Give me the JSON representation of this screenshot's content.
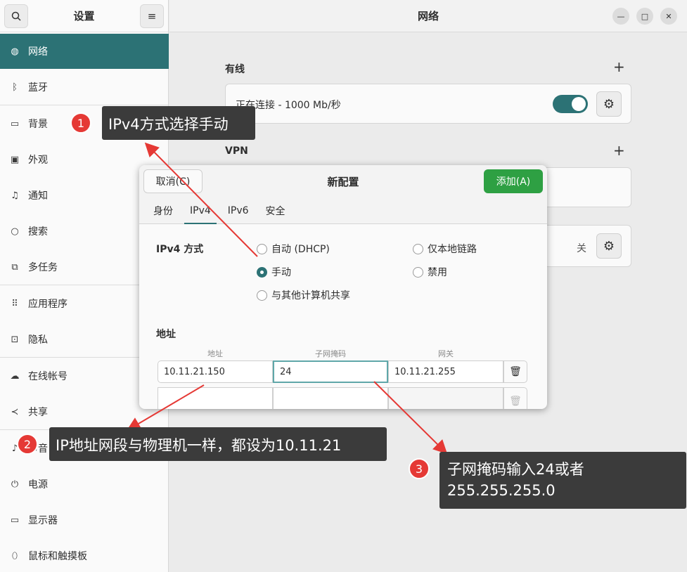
{
  "sidebar": {
    "title": "设置",
    "items": [
      {
        "label": "网络",
        "icon": "globe-icon"
      },
      {
        "label": "蓝牙",
        "icon": "bluetooth-icon"
      },
      {
        "label": "背景",
        "icon": "display-icon"
      },
      {
        "label": "外观",
        "icon": "appearance-icon"
      },
      {
        "label": "通知",
        "icon": "bell-icon"
      },
      {
        "label": "搜索",
        "icon": "search-icon"
      },
      {
        "label": "多任务",
        "icon": "multitask-icon"
      },
      {
        "label": "应用程序",
        "icon": "apps-icon"
      },
      {
        "label": "隐私",
        "icon": "lock-icon"
      },
      {
        "label": "在线帐号",
        "icon": "cloud-icon"
      },
      {
        "label": "共享",
        "icon": "share-icon"
      },
      {
        "label": "声音",
        "icon": "music-icon"
      },
      {
        "label": "电源",
        "icon": "power-icon"
      },
      {
        "label": "显示器",
        "icon": "monitor-icon"
      },
      {
        "label": "鼠标和触摸板",
        "icon": "mouse-icon"
      }
    ]
  },
  "header": {
    "title": "网络"
  },
  "wired": {
    "title": "有线",
    "status": "正在连接 - 1000 Mb/秒",
    "toggle_on": true
  },
  "vpn": {
    "title": "VPN"
  },
  "proxy": {
    "state": "关"
  },
  "dialog": {
    "title": "新配置",
    "cancel": "取消(C)",
    "add": "添加(A)",
    "tabs": [
      "身份",
      "IPv4",
      "IPv6",
      "安全"
    ],
    "active_tab": "IPv4",
    "method_label": "IPv4 方式",
    "methods": {
      "auto": "自动 (DHCP)",
      "link_local": "仅本地链路",
      "manual": "手动",
      "disabled": "禁用",
      "shared": "与其他计算机共享"
    },
    "selected_method": "手动",
    "address_section": "地址",
    "col_address": "地址",
    "col_netmask": "子网掩码",
    "col_gateway": "网关",
    "row1": {
      "address": "10.11.21.150",
      "netmask": "24",
      "gateway": "10.11.21.255"
    }
  },
  "annotations": [
    {
      "num": "1",
      "text": "IPv4方式选择手动"
    },
    {
      "num": "2",
      "text": "IP地址网段与物理机一样，都设为10.11.21"
    },
    {
      "num": "3",
      "line1": "子网掩码输入24或者",
      "line2": "255.255.255.0"
    }
  ],
  "colors": {
    "accent": "#2c7275",
    "add_button": "#2ea043",
    "badge": "#e53935",
    "arrow": "#e53935"
  }
}
